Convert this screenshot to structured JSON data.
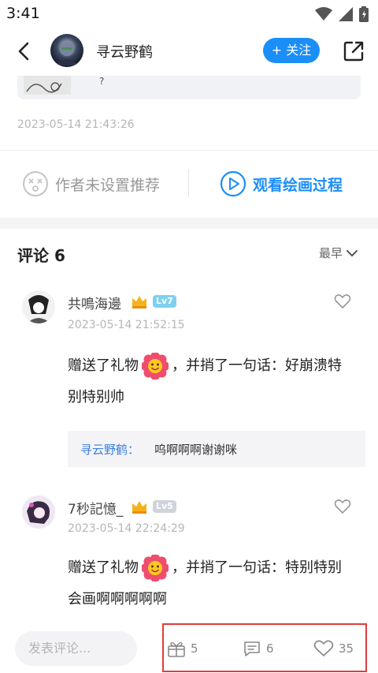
{
  "status_bar": {
    "time": "3:41"
  },
  "header": {
    "user_name": "寻云野鹤",
    "follow_label": "+ 关注"
  },
  "post": {
    "snippet_text": "?",
    "date": "2023-05-14 21:43:26",
    "no_recommend_label": "作者未设置推荐",
    "watch_process_label": "观看绘画过程"
  },
  "comments": {
    "title": "评论 6",
    "sort_label": "最早",
    "items": [
      {
        "name": "共鳴海邊",
        "level": "Lv7",
        "level_color": "#7fd0f0",
        "time": "2023-05-14 21:52:15",
        "text_before": "赠送了礼物",
        "text_after": "，并捎了一句话：好崩溃特别特别帅",
        "reply": {
          "name": "寻云野鹤：",
          "text": "呜啊啊啊谢谢咪"
        }
      },
      {
        "name": "7秒記憶_",
        "level": "Lv5",
        "level_color": "#cfd3da",
        "time": "2023-05-14 22:24:29",
        "text_before": "赠送了礼物",
        "text_after": "，并捎了一句话：特别特别会画啊啊啊啊啊"
      }
    ]
  },
  "bottom_bar": {
    "comment_placeholder": "发表评论...",
    "gift_count": "5",
    "comment_count": "6",
    "like_count": "35"
  },
  "colors": {
    "accent": "#1b8ef8",
    "highlight": "#e23b3b"
  }
}
